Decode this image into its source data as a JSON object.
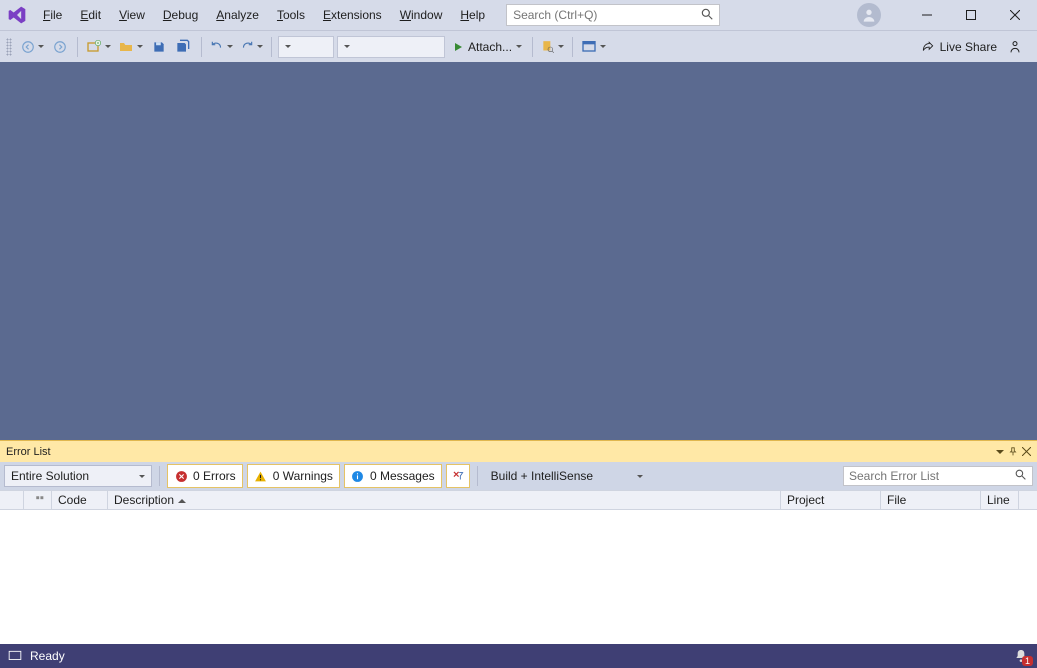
{
  "menu": {
    "items": [
      {
        "u": "F",
        "rest": "ile"
      },
      {
        "u": "E",
        "rest": "dit"
      },
      {
        "u": "V",
        "rest": "iew"
      },
      {
        "u": "D",
        "rest": "ebug"
      },
      {
        "u": "A",
        "rest": "nalyze"
      },
      {
        "u": "T",
        "rest": "ools"
      },
      {
        "u": "E",
        "rest": "xtensions"
      },
      {
        "u": "W",
        "rest": "indow"
      },
      {
        "u": "H",
        "rest": "elp"
      }
    ]
  },
  "search": {
    "placeholder": "Search (Ctrl+Q)"
  },
  "toolbar": {
    "attach_label": "Attach...",
    "live_share": "Live Share"
  },
  "panel": {
    "title": "Error List",
    "scope": "Entire Solution",
    "errors": "0 Errors",
    "warnings": "0 Warnings",
    "messages": "0 Messages",
    "source": "Build + IntelliSense",
    "search_placeholder": "Search Error List"
  },
  "grid": {
    "headers": {
      "code": "Code",
      "description": "Description",
      "project": "Project",
      "file": "File",
      "line": "Line"
    }
  },
  "status": {
    "text": "Ready",
    "badge": "1"
  }
}
